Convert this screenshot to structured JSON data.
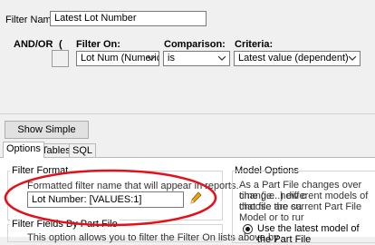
{
  "filter_name": {
    "label": "Filter Name:",
    "value": "Latest Lot Number"
  },
  "headers": {
    "and_or": "AND/OR",
    "paren": "(",
    "filter_on": "Filter On:",
    "comparison": "Comparison:",
    "criteria": "Criteria:"
  },
  "row": {
    "filter_on": "Lot Num (Numeric)",
    "comparison": "is",
    "criteria": "Latest value (dependent)"
  },
  "show_simple_label": "Show Simple",
  "tabs": [
    {
      "label": "Options",
      "active": true
    },
    {
      "label": "Tables",
      "active": false
    },
    {
      "label": "SQL",
      "active": false
    }
  ],
  "filter_format": {
    "legend": "Filter Format",
    "description": "Formatted filter name that will appear in reports.",
    "value": "Lot Number: [VALUES:1]"
  },
  "filter_fields": {
    "legend": "Filter Fields By Part File",
    "text": "This option allows you to filter the Filter On lists above by"
  },
  "model_options": {
    "legend": "Model Options",
    "lines": [
      "As a Part File changes over time (i.e. new c",
      "change...) different models of that file are sa",
      "choose the current Part File Model or to rur"
    ],
    "radio_label": "Use the latest model of the Part File"
  },
  "colors": {
    "annotation": "#e3101c",
    "pencil": "#e8a317"
  },
  "icons": [
    "chevron-down-icon",
    "pencil-icon",
    "radio-selected-icon"
  ]
}
